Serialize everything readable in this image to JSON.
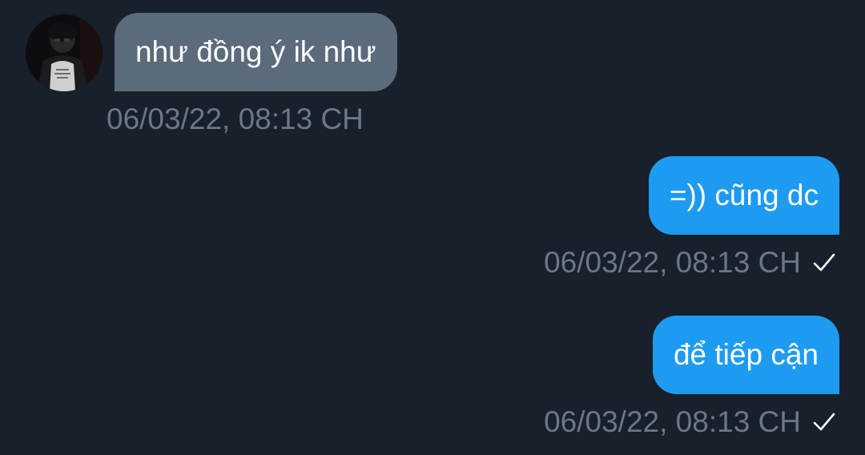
{
  "conversation": {
    "messages": [
      {
        "direction": "incoming",
        "text": "như đồng ý ik như",
        "timestamp": "06/03/22, 08:13 CH",
        "avatar_icon": "user-avatar"
      },
      {
        "direction": "outgoing",
        "text": "=)) cũng dc",
        "timestamp": "06/03/22, 08:13 CH",
        "status_icon": "check-icon"
      },
      {
        "direction": "outgoing",
        "text": "để tiếp cận",
        "timestamp": "06/03/22, 08:13 CH",
        "status_icon": "check-icon"
      }
    ]
  },
  "colors": {
    "background": "#17202b",
    "incoming_bubble": "#5b6b7c",
    "outgoing_bubble": "#1d9bf0",
    "timestamp": "#6a7786",
    "text": "#ffffff"
  }
}
